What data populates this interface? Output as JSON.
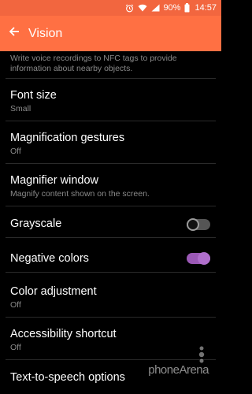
{
  "status_bar": {
    "battery": "90%",
    "time": "14:57"
  },
  "app_bar": {
    "title": "Vision"
  },
  "partial_item": {
    "description": "Write voice recordings to NFC tags to provide information about nearby objects."
  },
  "settings": [
    {
      "label": "Font size",
      "sub": "Small"
    },
    {
      "label": "Magnification gestures",
      "sub": "Off"
    },
    {
      "label": "Magnifier window",
      "sub": "Magnify content shown on the screen."
    },
    {
      "label": "Grayscale",
      "toggle": "off"
    },
    {
      "label": "Negative colors",
      "toggle": "on"
    },
    {
      "label": "Color adjustment",
      "sub": "Off"
    },
    {
      "label": "Accessibility shortcut",
      "sub": "Off"
    },
    {
      "label": "Text-to-speech options"
    }
  ],
  "watermark": {
    "text": "phoneArena"
  },
  "colors": {
    "status_bar": "#f2663f",
    "app_bar": "#ff7043",
    "toggle_on": "#9b59b6"
  }
}
